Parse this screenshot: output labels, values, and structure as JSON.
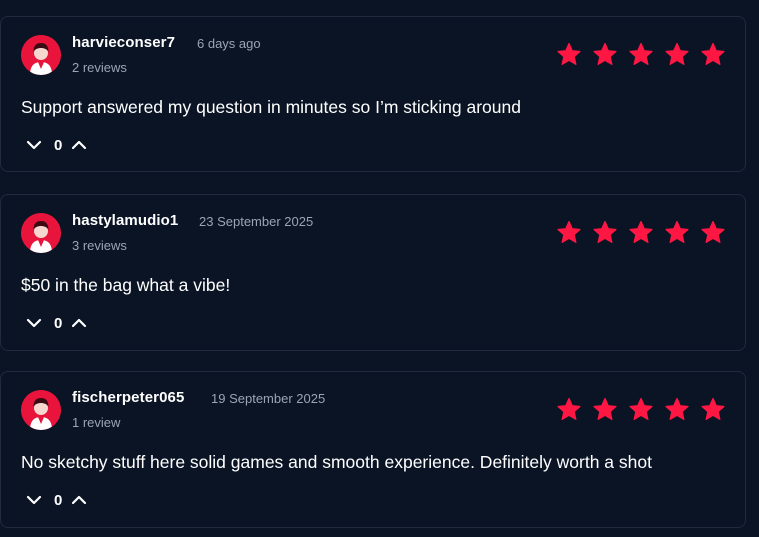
{
  "accent_color": "#ff1744",
  "reviews": [
    {
      "username": "harvieconser7",
      "date": "6 days ago",
      "review_count": "2 reviews",
      "rating": 5,
      "text": "Support answered my question in minutes so I’m sticking around",
      "votes": "0"
    },
    {
      "username": "hastylamudio1",
      "date": "23 September 2025",
      "review_count": "3 reviews",
      "rating": 5,
      "text": "$50 in the bag what a vibe!",
      "votes": "0"
    },
    {
      "username": "fischerpeter065",
      "date": "19 September 2025",
      "review_count": "1 review",
      "rating": 5,
      "text": "No sketchy stuff here solid games and smooth experience. Definitely worth a shot",
      "votes": "0"
    }
  ],
  "icons": {
    "avatar": "user-avatar-icon",
    "star": "star-icon",
    "downvote": "chevron-down-icon",
    "upvote": "chevron-up-icon"
  }
}
